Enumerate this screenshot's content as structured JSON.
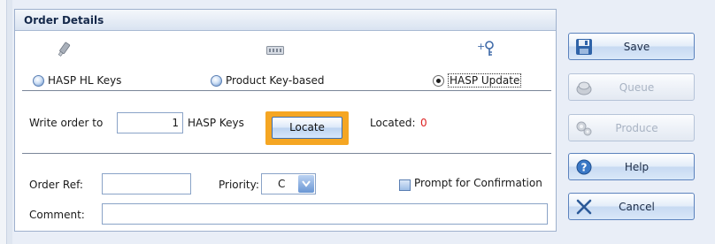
{
  "panel": {
    "title": "Order Details"
  },
  "key_types": [
    {
      "label": "HASP HL Keys",
      "icon": "hasp-hl-key-icon",
      "checked": false
    },
    {
      "label": "Product Key-based",
      "icon": "product-key-icon",
      "checked": false
    },
    {
      "label": "HASP Update",
      "icon": "hasp-update-icon",
      "checked": true
    }
  ],
  "write_order": {
    "prefix_label": "Write order to",
    "quantity": "1",
    "unit_label": "HASP Keys",
    "locate_label": "Locate",
    "located_label": "Located:",
    "located_value": "0"
  },
  "order_ref": {
    "label": "Order Ref:",
    "value": ""
  },
  "priority": {
    "label": "Priority:",
    "value": "C"
  },
  "prompt_confirmation": {
    "label": "Prompt for Confirmation",
    "checked": false
  },
  "comment": {
    "label": "Comment:",
    "value": ""
  },
  "actions": {
    "save": {
      "label": "Save",
      "enabled": true
    },
    "queue": {
      "label": "Queue",
      "enabled": false
    },
    "produce": {
      "label": "Produce",
      "enabled": false
    },
    "help": {
      "label": "Help",
      "enabled": true
    },
    "cancel": {
      "label": "Cancel",
      "enabled": true
    }
  },
  "colors": {
    "highlight": "#f5a623",
    "located_value": "#dd2222",
    "panel_header": "#15294b"
  }
}
